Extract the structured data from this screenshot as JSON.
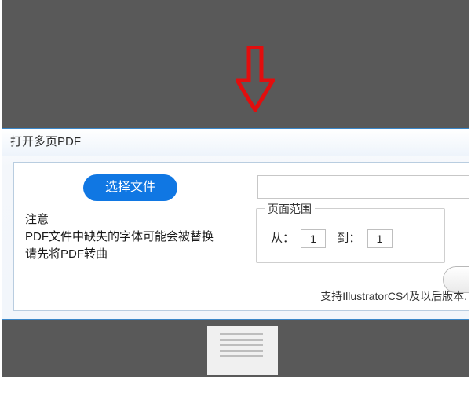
{
  "dialog": {
    "title": "打开多页PDF",
    "choose_file_label": "选择文件",
    "file_path_value": "",
    "warning_heading": "注意",
    "warning_line1": "PDF文件中缺失的字体可能会被替换",
    "warning_line2": "请先将PDF转曲",
    "page_range": {
      "legend": "页面范围",
      "from_label": "从：",
      "from_value": "1",
      "to_label": "到：",
      "to_value": "1"
    },
    "support_text": "支持IllustratorCS4及以后版本."
  },
  "arrow": {
    "color": "#e20e0e"
  }
}
